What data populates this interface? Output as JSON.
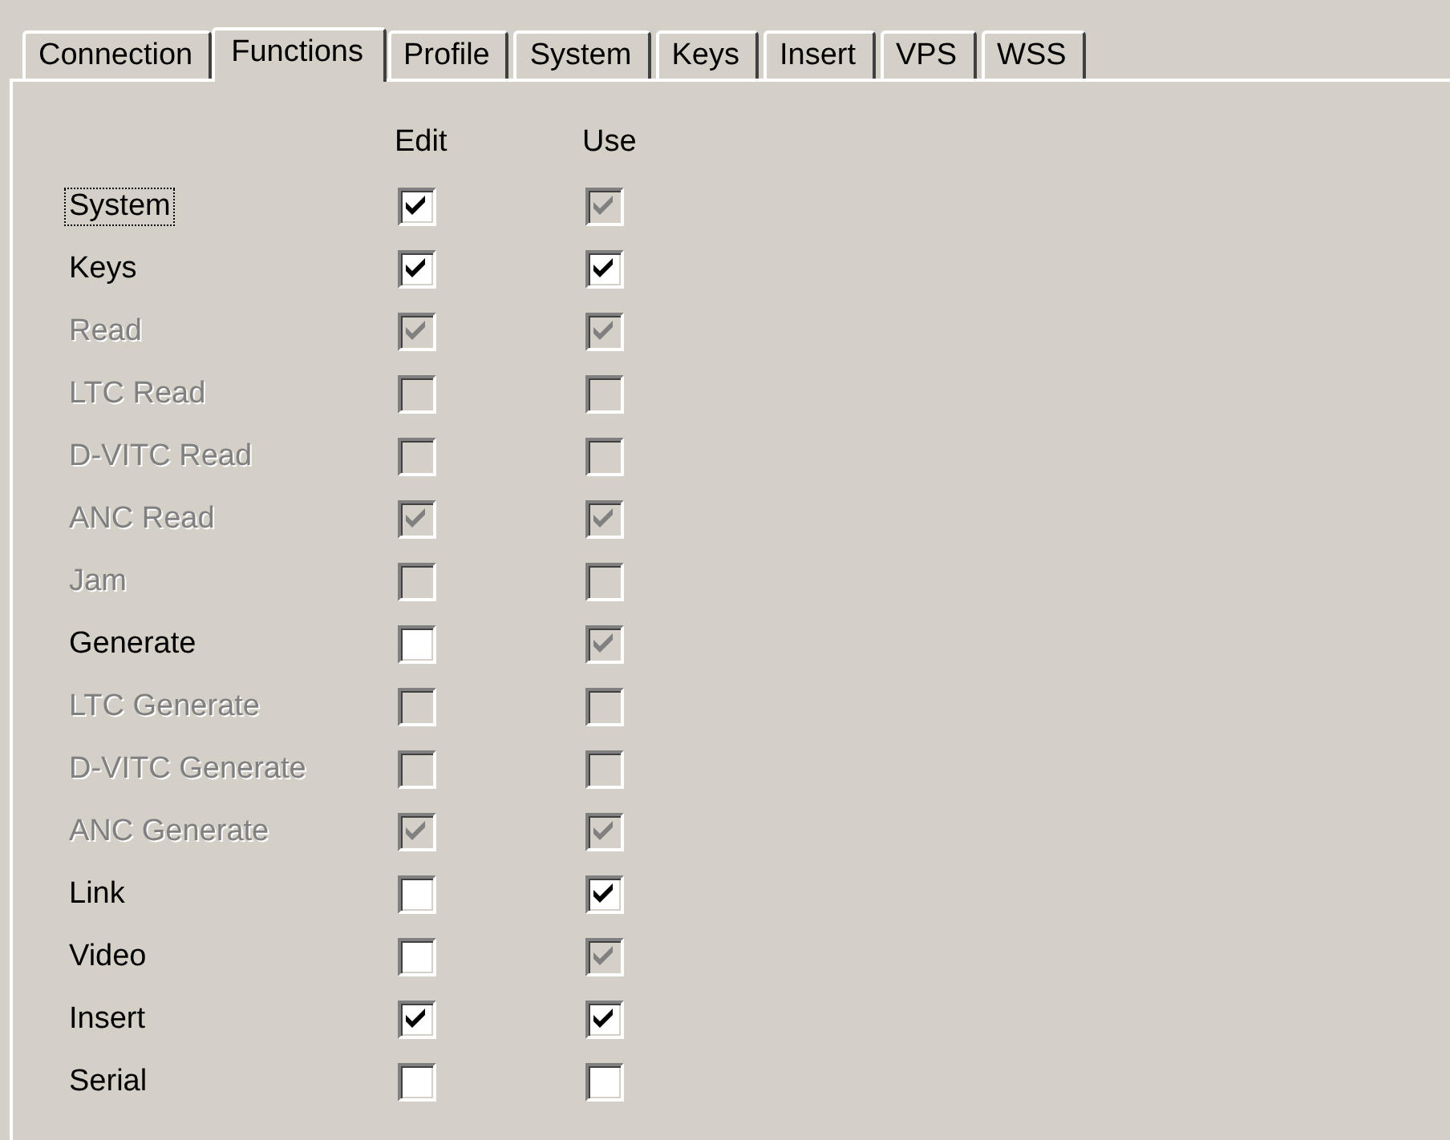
{
  "tabs": [
    {
      "label": "Connection",
      "selected": false
    },
    {
      "label": "Functions",
      "selected": true
    },
    {
      "label": "Profile",
      "selected": false
    },
    {
      "label": "System",
      "selected": false
    },
    {
      "label": "Keys",
      "selected": false
    },
    {
      "label": "Insert",
      "selected": false
    },
    {
      "label": "VPS",
      "selected": false
    },
    {
      "label": "WSS",
      "selected": false
    }
  ],
  "columns": [
    "Edit",
    "Use"
  ],
  "rows": [
    {
      "label": "System",
      "focused": true,
      "disabled": false,
      "edit": {
        "checked": true,
        "disabled": false
      },
      "use": {
        "checked": true,
        "disabled": true
      }
    },
    {
      "label": "Keys",
      "focused": false,
      "disabled": false,
      "edit": {
        "checked": true,
        "disabled": false
      },
      "use": {
        "checked": true,
        "disabled": false
      }
    },
    {
      "label": "Read",
      "focused": false,
      "disabled": true,
      "edit": {
        "checked": true,
        "disabled": true
      },
      "use": {
        "checked": true,
        "disabled": true
      }
    },
    {
      "label": "LTC Read",
      "focused": false,
      "disabled": true,
      "edit": {
        "checked": false,
        "disabled": true
      },
      "use": {
        "checked": false,
        "disabled": true
      }
    },
    {
      "label": "D-VITC Read",
      "focused": false,
      "disabled": true,
      "edit": {
        "checked": false,
        "disabled": true
      },
      "use": {
        "checked": false,
        "disabled": true
      }
    },
    {
      "label": "ANC Read",
      "focused": false,
      "disabled": true,
      "edit": {
        "checked": true,
        "disabled": true
      },
      "use": {
        "checked": true,
        "disabled": true
      }
    },
    {
      "label": "Jam",
      "focused": false,
      "disabled": true,
      "edit": {
        "checked": false,
        "disabled": true
      },
      "use": {
        "checked": false,
        "disabled": true
      }
    },
    {
      "label": "Generate",
      "focused": false,
      "disabled": false,
      "edit": {
        "checked": false,
        "disabled": false
      },
      "use": {
        "checked": true,
        "disabled": true
      }
    },
    {
      "label": "LTC Generate",
      "focused": false,
      "disabled": true,
      "edit": {
        "checked": false,
        "disabled": true
      },
      "use": {
        "checked": false,
        "disabled": true
      }
    },
    {
      "label": "D-VITC Generate",
      "focused": false,
      "disabled": true,
      "edit": {
        "checked": false,
        "disabled": true
      },
      "use": {
        "checked": false,
        "disabled": true
      }
    },
    {
      "label": "ANC Generate",
      "focused": false,
      "disabled": true,
      "edit": {
        "checked": true,
        "disabled": true
      },
      "use": {
        "checked": true,
        "disabled": true
      }
    },
    {
      "label": "Link",
      "focused": false,
      "disabled": false,
      "edit": {
        "checked": false,
        "disabled": false
      },
      "use": {
        "checked": true,
        "disabled": false
      }
    },
    {
      "label": "Video",
      "focused": false,
      "disabled": false,
      "edit": {
        "checked": false,
        "disabled": false
      },
      "use": {
        "checked": true,
        "disabled": true
      }
    },
    {
      "label": "Insert",
      "focused": false,
      "disabled": false,
      "edit": {
        "checked": true,
        "disabled": false
      },
      "use": {
        "checked": true,
        "disabled": false
      }
    },
    {
      "label": "Serial",
      "focused": false,
      "disabled": false,
      "edit": {
        "checked": false,
        "disabled": false
      },
      "use": {
        "checked": false,
        "disabled": false
      }
    }
  ]
}
